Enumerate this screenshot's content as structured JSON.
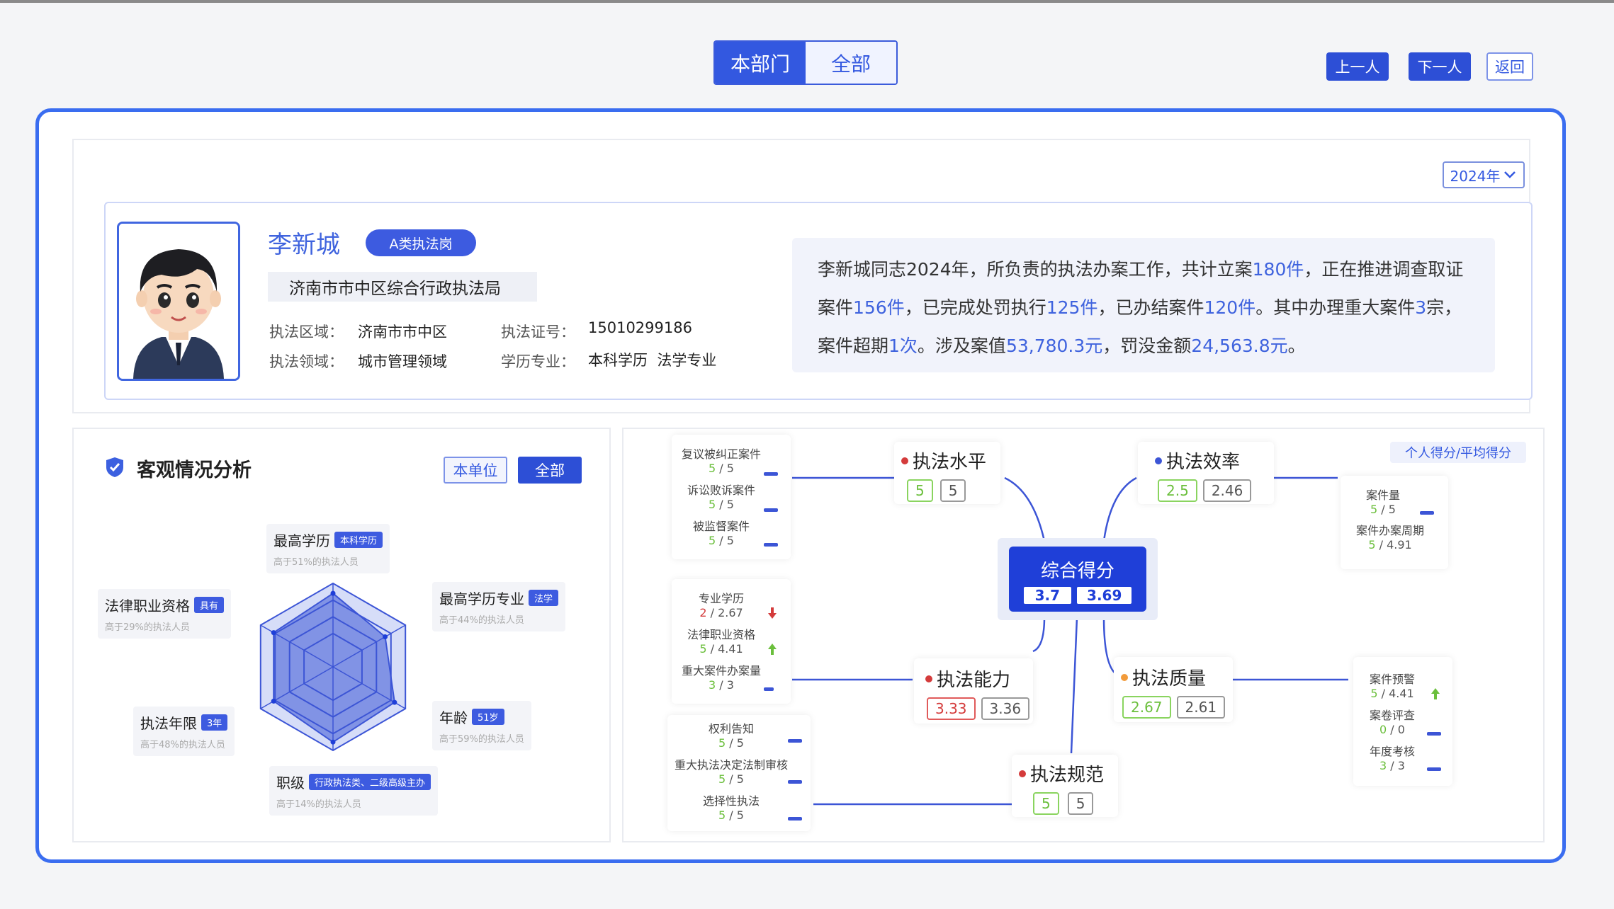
{
  "tabs": {
    "dept": "本部门",
    "all": "全部"
  },
  "nav": {
    "prev": "上一人",
    "next": "下一人",
    "back": "返回"
  },
  "year_select": "2024年",
  "profile": {
    "name": "李新城",
    "tag": "A类执法岗",
    "org": "济南市市中区综合行政执法局",
    "area_label": "执法区域：",
    "area_value": "济南市市中区",
    "cert_label": "执法证号：",
    "cert_value": "15010299186",
    "field_label": "执法领域：",
    "field_value": "城市管理领域",
    "edu_label": "学历专业：",
    "edu_value": "本科学历  法学专业"
  },
  "summary": {
    "t1": "李新城同志2024年，所负责的执法办案工作，共计立案",
    "v1": "180件",
    "t2": "，正在推进调查取证案件",
    "v2": "156件",
    "t3": "，已完成处罚执行",
    "v3": "125件",
    "t4": "，已办结案件",
    "v4": "120件",
    "t5": "。其中办理重大案件",
    "v5": "3",
    "t6": "宗，案件超期",
    "v6": "1次",
    "t7": "。涉及案值",
    "v7": "53,780.3元",
    "t8": "，罚没金额",
    "v8": "24,563.8元",
    "t9": "。"
  },
  "objective": {
    "title": "客观情况分析",
    "btn_unit": "本单位",
    "btn_all": "全部",
    "items": [
      {
        "label": "最高学历",
        "badge": "本科学历",
        "sub": "高于51%的执法人员"
      },
      {
        "label": "最高学历专业",
        "badge": "法学",
        "sub": "高于44%的执法人员"
      },
      {
        "label": "年龄",
        "badge": "51岁",
        "sub": "高于59%的执法人员"
      },
      {
        "label": "职级",
        "badge": "行政执法类、二级高级主办",
        "sub": "高于14%的执法人员"
      },
      {
        "label": "执法年限",
        "badge": "3年",
        "sub": "高于48%的执法人员"
      },
      {
        "label": "法律职业资格",
        "badge": "具有",
        "sub": "高于29%的执法人员"
      }
    ],
    "radar_values": [
      0.88,
      0.72,
      0.85,
      0.9,
      0.82,
      0.82
    ]
  },
  "mindmap": {
    "legend": "个人得分/平均得分",
    "center": {
      "title": "综合得分",
      "personal": "3.7",
      "average": "3.69"
    },
    "level": {
      "title": "执法水平",
      "personal": "5",
      "average": "5",
      "dot": "#d43b3b"
    },
    "efficiency": {
      "title": "执法效率",
      "personal": "2.5",
      "average": "2.46",
      "dot": "#3c55d6"
    },
    "ability": {
      "title": "执法能力",
      "personal": "3.33",
      "average": "3.36",
      "dot": "#d43b3b"
    },
    "quality": {
      "title": "执法质量",
      "personal": "2.67",
      "average": "2.61",
      "dot": "#f29b3a"
    },
    "norm": {
      "title": "执法规范",
      "personal": "5",
      "average": "5",
      "dot": "#d43b3b"
    },
    "level_items": [
      {
        "name": "复议被纠正案件",
        "p": "5",
        "a": "5"
      },
      {
        "name": "诉讼败诉案件",
        "p": "5",
        "a": "5"
      },
      {
        "name": "被监督案件",
        "p": "5",
        "a": "5"
      }
    ],
    "ability_items": [
      {
        "name": "专业学历",
        "p": "2",
        "a": "2.67"
      },
      {
        "name": "法律职业资格",
        "p": "5",
        "a": "4.41"
      },
      {
        "name": "重大案件办案量",
        "p": "3",
        "a": "3"
      }
    ],
    "norm_items": [
      {
        "name": "权利告知",
        "p": "5",
        "a": "5"
      },
      {
        "name": "重大执法决定法制审核",
        "p": "5",
        "a": "5"
      },
      {
        "name": "选择性执法",
        "p": "5",
        "a": "5"
      }
    ],
    "eff_items": [
      {
        "name": "案件量",
        "p": "5",
        "a": "5"
      },
      {
        "name": "案件办案周期",
        "p": "5",
        "a": "4.91"
      }
    ],
    "quality_items": [
      {
        "name": "案件预警",
        "p": "5",
        "a": "4.41"
      },
      {
        "name": "案卷评查",
        "p": "0",
        "a": "0"
      },
      {
        "name": "年度考核",
        "p": "3",
        "a": "3"
      }
    ],
    "sep": " / "
  }
}
